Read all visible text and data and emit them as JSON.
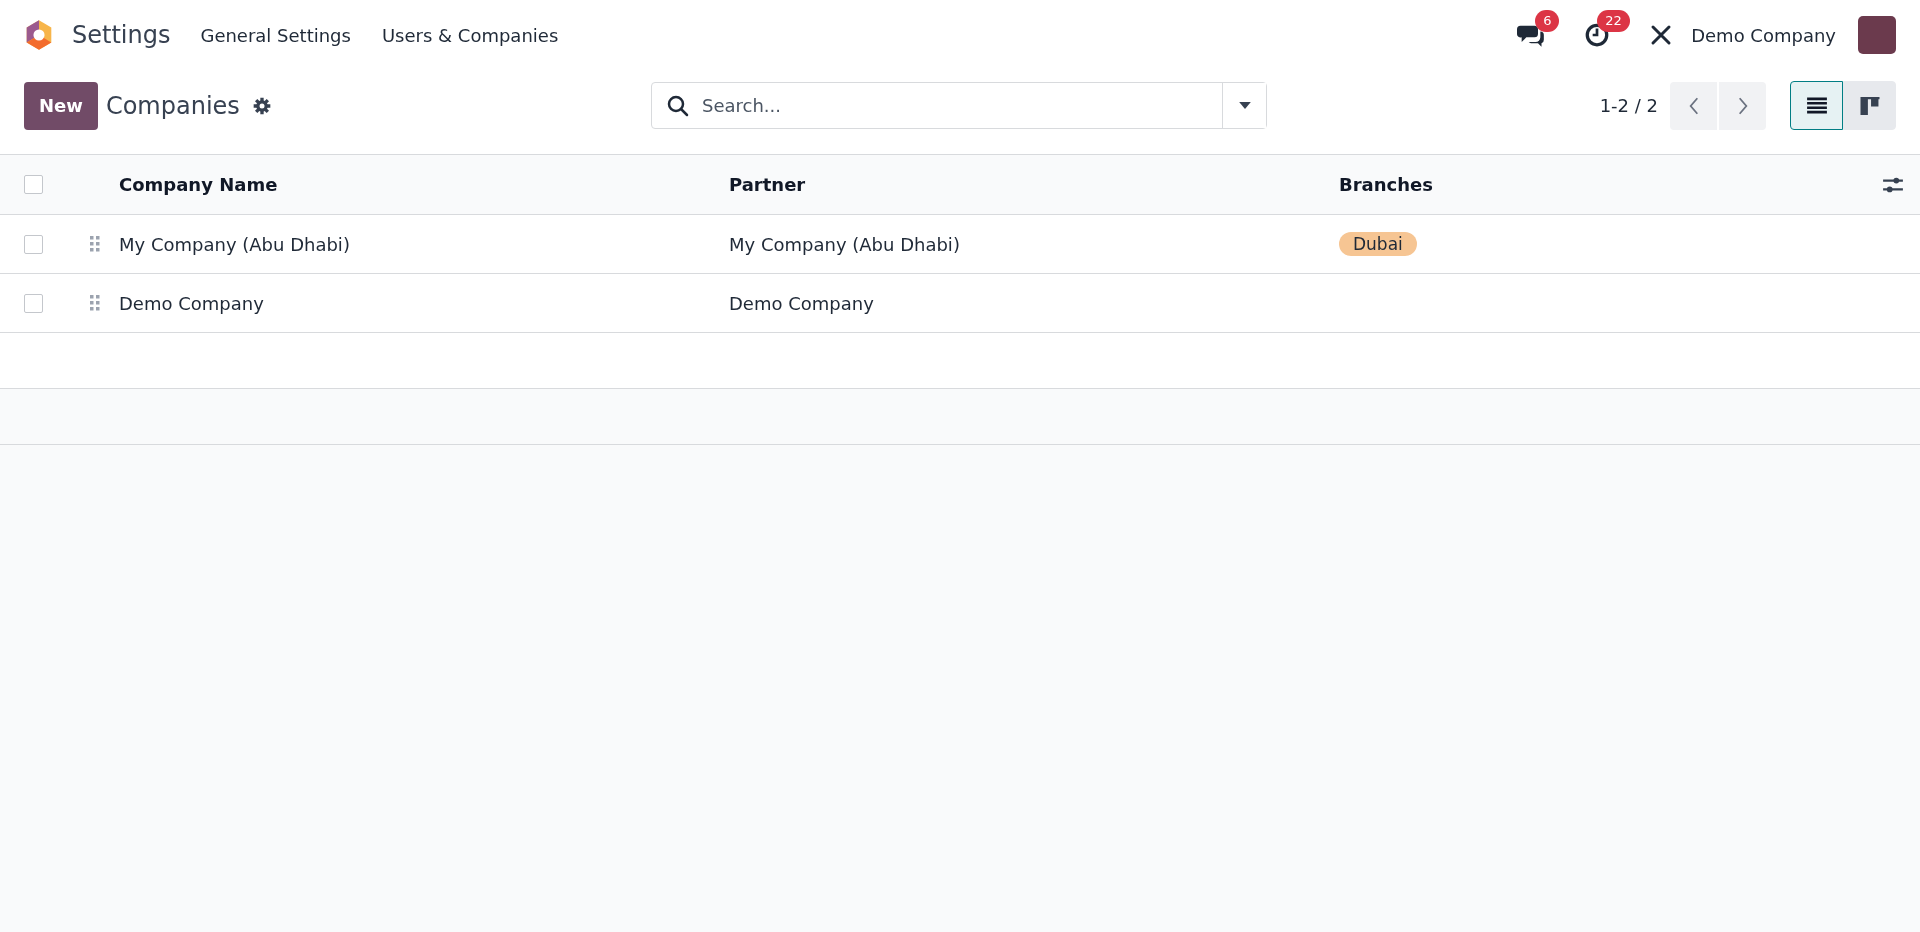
{
  "navbar": {
    "app_name": "Settings",
    "menus": [
      "General Settings",
      "Users & Companies"
    ],
    "messages_badge": "6",
    "activities_badge": "22",
    "company": "Demo Company"
  },
  "control_panel": {
    "new_button": "New",
    "title": "Companies",
    "search": {
      "placeholder": "Search..."
    },
    "pager": "1-2 / 2",
    "views": [
      {
        "kind": "list",
        "selected": true
      },
      {
        "kind": "kanban",
        "selected": false
      }
    ]
  },
  "table": {
    "select_all": {
      "checked": false
    },
    "columns": [
      "Company Name",
      "Partner",
      "Branches"
    ],
    "rows": [
      {
        "checked": false,
        "company_name": "My Company (Abu Dhabi)",
        "partner": "My Company (Abu Dhabi)",
        "branches": [
          {
            "label": "Dubai",
            "color": "#f6c593"
          }
        ]
      },
      {
        "checked": false,
        "company_name": "Demo Company",
        "partner": "Demo Company",
        "branches": []
      }
    ]
  }
}
